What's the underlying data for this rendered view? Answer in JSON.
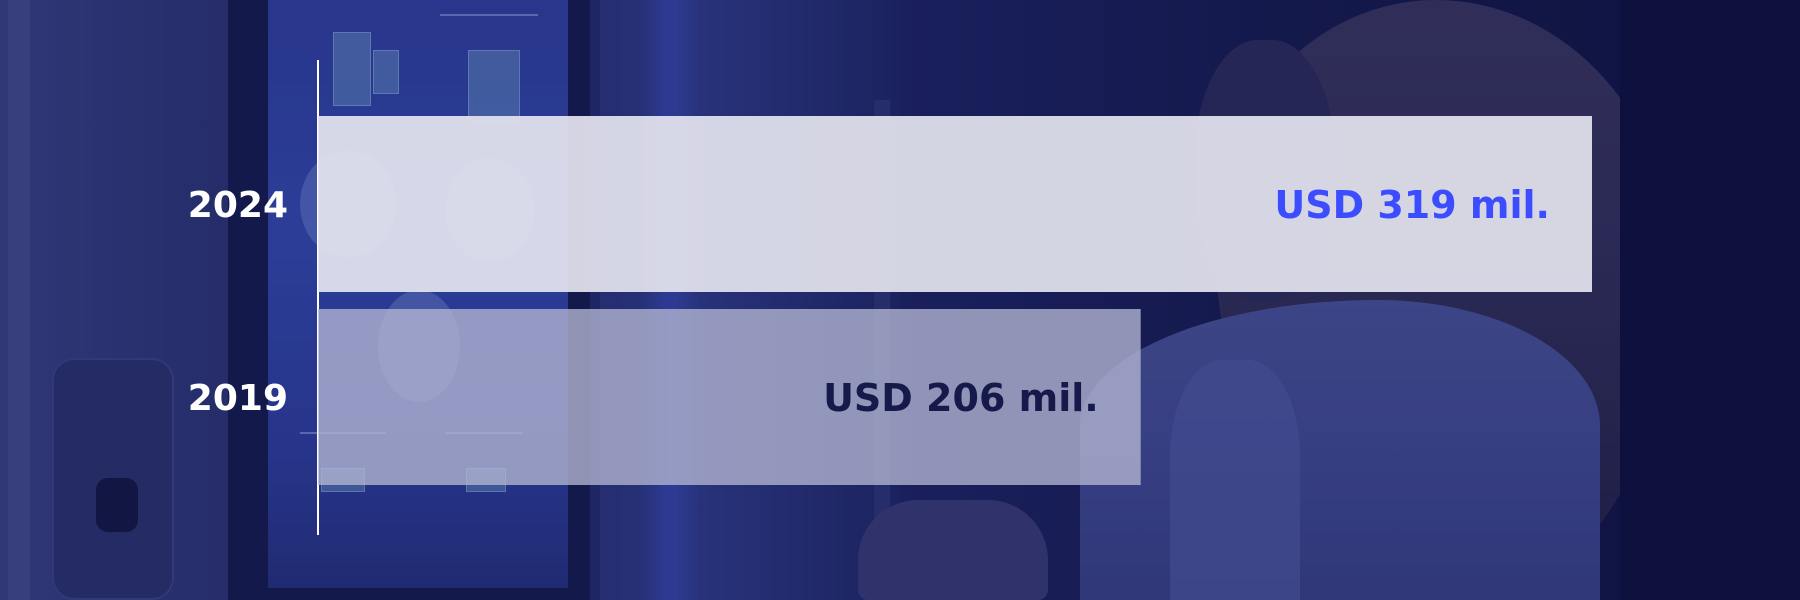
{
  "chart_data": {
    "type": "bar",
    "orientation": "horizontal",
    "categories": [
      "2024",
      "2019"
    ],
    "values": [
      319,
      206
    ],
    "data_labels": [
      "USD 319 mil.",
      "USD 206 mil."
    ],
    "xlim": [
      0,
      319
    ],
    "title": "",
    "xlabel": "",
    "ylabel": "",
    "grid": false,
    "legend": "none"
  },
  "colors": {
    "bar_2024_fill": "#e3e3ee",
    "bar_2019_fill": "#b4b6d2",
    "label_2024": "#3b4dff",
    "label_2019": "#161a4a",
    "axis_line": "#ffffff",
    "tick_text": "#ffffff"
  }
}
